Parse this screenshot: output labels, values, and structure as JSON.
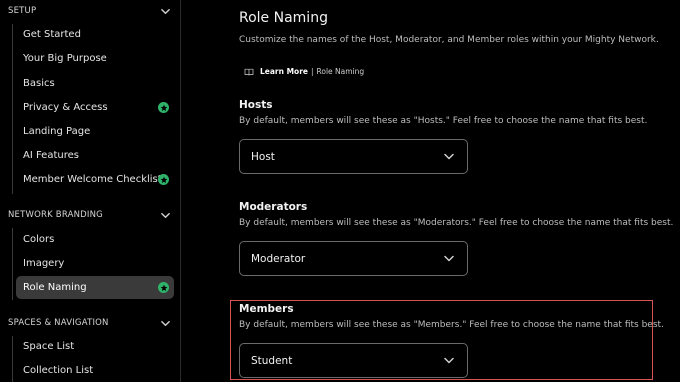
{
  "sidebar": {
    "sections": [
      {
        "title": "SETUP",
        "items": [
          {
            "label": "Get Started",
            "badge": false,
            "selected": false
          },
          {
            "label": "Your Big Purpose",
            "badge": false,
            "selected": false
          },
          {
            "label": "Basics",
            "badge": false,
            "selected": false
          },
          {
            "label": "Privacy & Access",
            "badge": true,
            "selected": false
          },
          {
            "label": "Landing Page",
            "badge": false,
            "selected": false
          },
          {
            "label": "AI Features",
            "badge": false,
            "selected": false
          },
          {
            "label": "Member Welcome Checklist",
            "badge": true,
            "selected": false
          }
        ]
      },
      {
        "title": "NETWORK BRANDING",
        "items": [
          {
            "label": "Colors",
            "badge": false,
            "selected": false
          },
          {
            "label": "Imagery",
            "badge": false,
            "selected": false
          },
          {
            "label": "Role Naming",
            "badge": true,
            "selected": true
          }
        ]
      },
      {
        "title": "SPACES & NAVIGATION",
        "items": [
          {
            "label": "Space List",
            "badge": false,
            "selected": false
          },
          {
            "label": "Collection List",
            "badge": false,
            "selected": false
          }
        ]
      }
    ]
  },
  "main": {
    "title": "Role Naming",
    "subtitle": "Customize the names of the Host, Moderator, and Member roles within your Mighty Network.",
    "learn_more": {
      "bold": "Learn More",
      "separator": "|",
      "link": "Role Naming"
    },
    "groups": [
      {
        "title": "Hosts",
        "description": "By default, members will see these as \"Hosts.\" Feel free to choose the name that fits best.",
        "value": "Host"
      },
      {
        "title": "Moderators",
        "description": "By default, members will see these as \"Moderators.\" Feel free to choose the name that fits best.",
        "value": "Moderator"
      },
      {
        "title": "Members",
        "description": "By default, members will see these as \"Members.\" Feel free to choose the name that fits best.",
        "value": "Student"
      }
    ]
  },
  "colors": {
    "background": "#000000",
    "selected_item": "#3a3a3a",
    "badge_green": "#2fb36b",
    "highlight_red": "#d9534f"
  },
  "icons": {
    "section_toggle": "chevron-down-icon",
    "badge": "star-badge-icon",
    "learn_more": "book-icon",
    "select_arrow": "chevron-down-icon"
  }
}
